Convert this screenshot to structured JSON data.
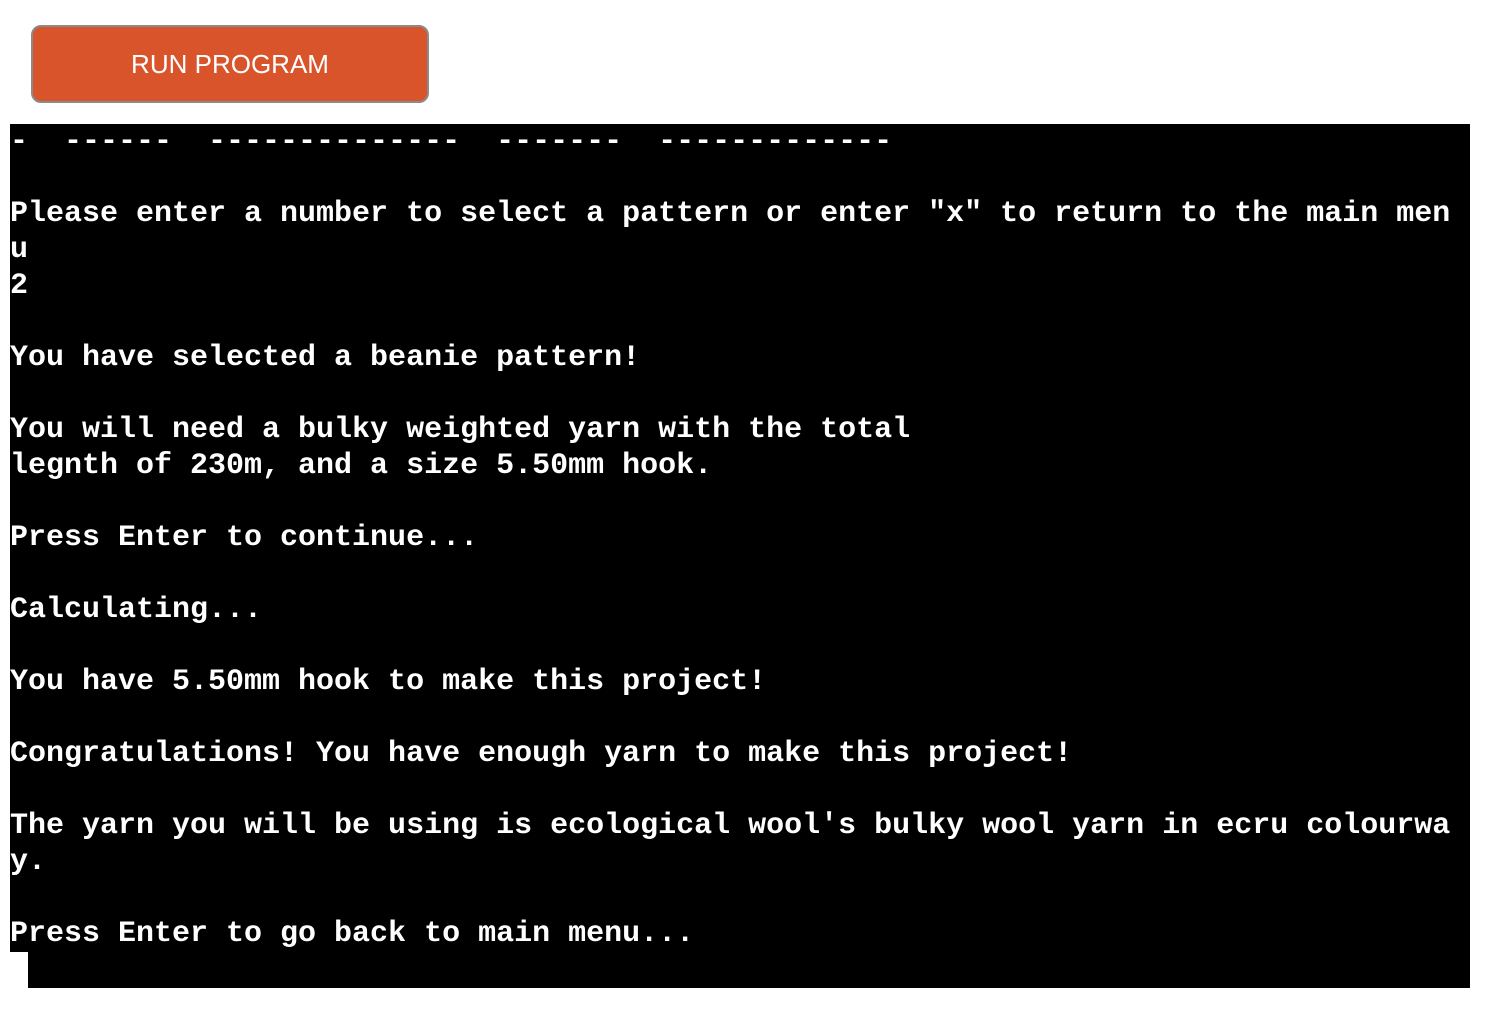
{
  "toolbar": {
    "run_label": "RUN PROGRAM"
  },
  "colors": {
    "button_bg": "#d9542b",
    "terminal_bg": "#000000",
    "terminal_fg": "#ffffff"
  },
  "terminal": {
    "lines": [
      "-  ------  --------------  -------  -------------",
      "",
      "Please enter a number to select a pattern or enter \"x\" to return to the main men",
      "u",
      "2",
      "",
      "You have selected a beanie pattern!",
      "",
      "You will need a bulky weighted yarn with the total",
      "legnth of 230m, and a size 5.50mm hook.",
      "",
      "Press Enter to continue...",
      "",
      "Calculating...",
      "",
      "You have 5.50mm hook to make this project!",
      "",
      "Congratulations! You have enough yarn to make this project!",
      "",
      "The yarn you will be using is ecological wool's bulky wool yarn in ecru colourwa",
      "y.",
      "",
      "Press Enter to go back to main menu..."
    ]
  }
}
